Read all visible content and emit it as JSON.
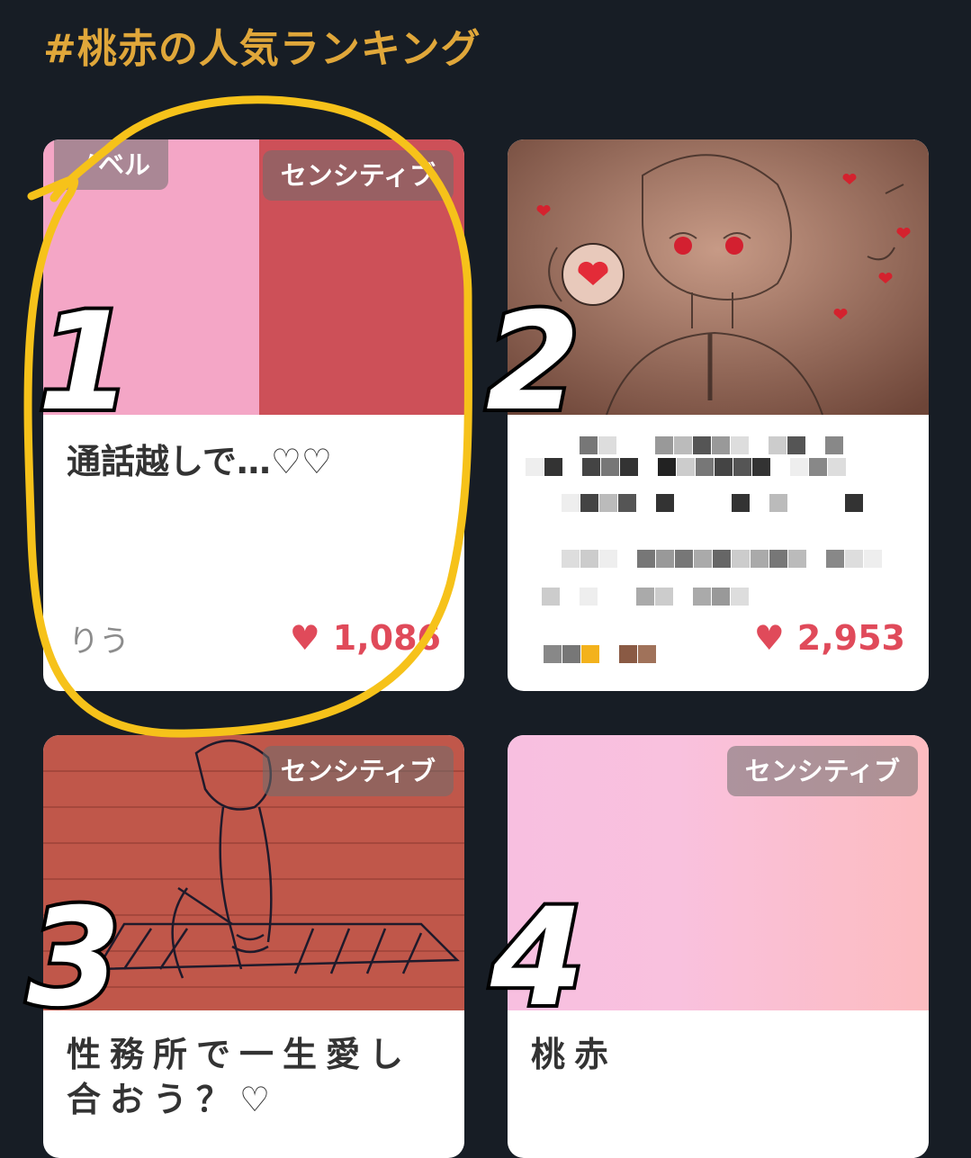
{
  "heading": "#桃赤の人気ランキング",
  "colors": {
    "background": "#171d25",
    "heading": "#e0a73a",
    "like": "#e04a5a",
    "annotation": "#f6c21a"
  },
  "cards": [
    {
      "rank": "1",
      "tags": [
        "ノベル",
        "センシティブ"
      ],
      "title": "通話越しで…♡♡",
      "author": "りう",
      "likes": "1,086",
      "heart_icon": "heart-icon"
    },
    {
      "rank": "2",
      "tags": [],
      "title": "",
      "author": "",
      "likes": "2,953",
      "heart_icon": "heart-icon"
    },
    {
      "rank": "3",
      "tags": [
        "センシティブ"
      ],
      "title": "性務所で一生愛し合おう？♡",
      "author": "",
      "likes": ""
    },
    {
      "rank": "4",
      "tags": [
        "センシティブ"
      ],
      "title": "桃赤",
      "author": "",
      "likes": ""
    }
  ]
}
